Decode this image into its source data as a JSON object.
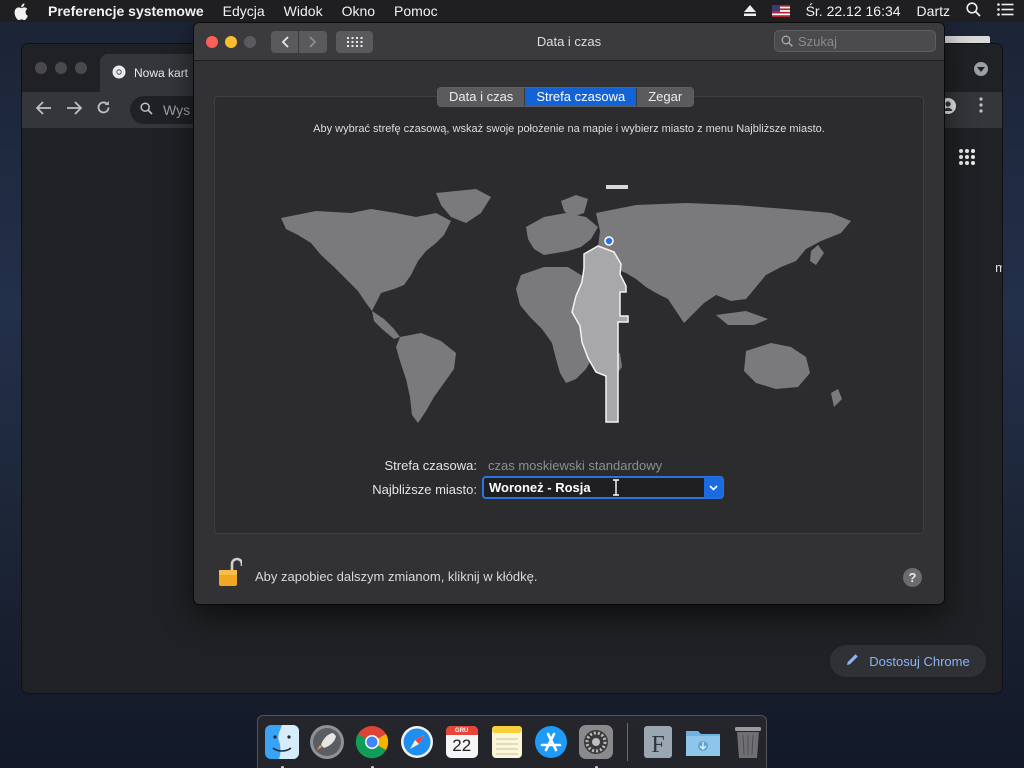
{
  "menubar": {
    "app_name": "Preferencje systemowe",
    "menus": [
      "Edycja",
      "Widok",
      "Okno",
      "Pomoc"
    ],
    "datetime": "Śr. 22.12  16:34",
    "user": "Dartz"
  },
  "chrome": {
    "tab_title": "Nowa kart",
    "omnibox_text": "Wys",
    "customize_label": "Dostosuj Chrome",
    "edge_letter": "m"
  },
  "window": {
    "title": "Data i czas",
    "search_placeholder": "Szukaj",
    "tabs": [
      {
        "label": "Data i czas",
        "active": false
      },
      {
        "label": "Strefa czasowa",
        "active": true
      },
      {
        "label": "Zegar",
        "active": false
      }
    ],
    "hint": "Aby wybrać strefę czasową, wskaż swoje położenie na mapie i wybierz miasto z menu Najbliższe miasto.",
    "timezone_label": "Strefa czasowa:",
    "timezone_value": "czas moskiewski standardowy",
    "city_label": "Najbliższe miasto:",
    "city_value": "Woroneż - Rosja",
    "lock_text": "Aby zapobiec dalszym zmianom, kliknij w kłódkę.",
    "help_label": "?"
  },
  "dock": {
    "calendar_month": "GRU",
    "calendar_day": "22",
    "apps": [
      "finder",
      "launchpad",
      "chrome",
      "safari",
      "calendar",
      "notes",
      "app-store",
      "system-preferences",
      "font-book",
      "downloads",
      "trash"
    ]
  },
  "colors": {
    "accent": "#1363d6",
    "close": "#fe5f57",
    "minimize": "#febc2e"
  }
}
